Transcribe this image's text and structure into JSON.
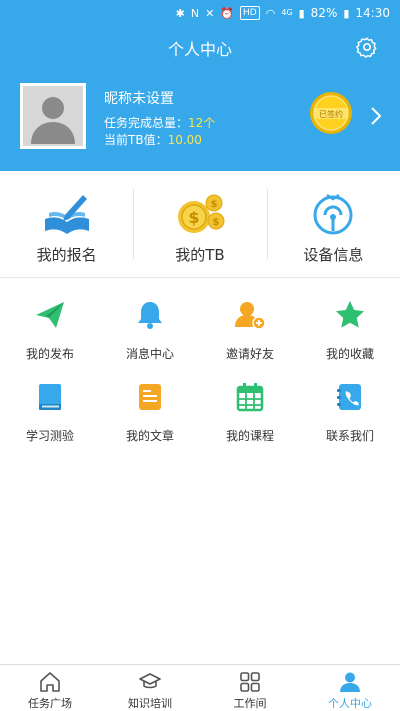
{
  "status_bar": {
    "battery": "82%",
    "time": "14:30",
    "hd": "HD",
    "network": "4G"
  },
  "header": {
    "title": "个人中心",
    "nickname": "昵称未设置",
    "tasks_label": "任务完成总量：",
    "tasks_value": "12个",
    "tb_label": "当前TB值：",
    "tb_value": "10.00",
    "badge_text": "已签约"
  },
  "top_actions": [
    {
      "label": "我的报名"
    },
    {
      "label": "我的TB"
    },
    {
      "label": "设备信息"
    }
  ],
  "grid": [
    {
      "label": "我的发布"
    },
    {
      "label": "消息中心"
    },
    {
      "label": "邀请好友"
    },
    {
      "label": "我的收藏"
    },
    {
      "label": "学习测验"
    },
    {
      "label": "我的文章"
    },
    {
      "label": "我的课程"
    },
    {
      "label": "联系我们"
    }
  ],
  "bottom_nav": [
    {
      "label": "任务广场"
    },
    {
      "label": "知识培训"
    },
    {
      "label": "工作间"
    },
    {
      "label": "个人中心"
    }
  ],
  "colors": {
    "primary": "#37a8ea",
    "highlight": "#ffe34a",
    "green": "#2fbf71",
    "orange": "#f5a623",
    "gold": "#f2c230"
  }
}
